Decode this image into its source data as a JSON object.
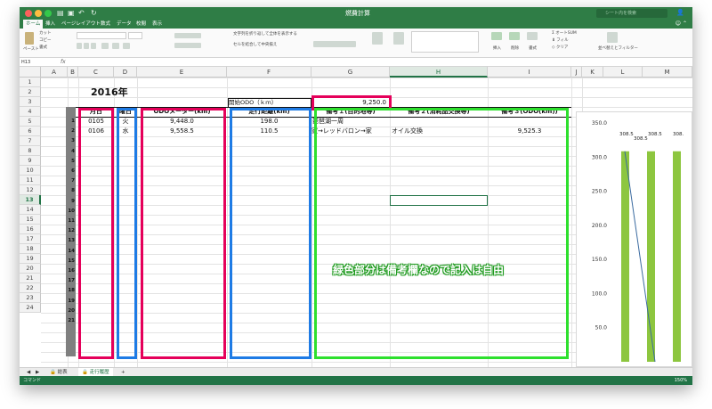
{
  "window": {
    "title": "燃費計算",
    "search_placeholder": "シート内を検索"
  },
  "ribbon_tabs": [
    "ホーム",
    "挿入",
    "ページレイアウト",
    "数式",
    "データ",
    "校閲",
    "表示"
  ],
  "ribbon": {
    "paste": "ペースト",
    "cut": "カット",
    "copy": "コピー",
    "format": "書式",
    "wrap": "文字列を折り返して全体を表示する",
    "merge": "セルを結合して中央揃え",
    "autosum": "オートSUM",
    "fill": "フィル",
    "clear": "クリア",
    "insert": "挿入",
    "delete": "削除",
    "cell_format": "書式",
    "sort": "並べ替えとフィルター"
  },
  "formula_bar": {
    "name_box": "H13",
    "fx": "fx"
  },
  "columns": [
    "A",
    "B",
    "C",
    "D",
    "E",
    "F",
    "G",
    "H",
    "I",
    "J",
    "K",
    "L",
    "M"
  ],
  "rows": [
    "1",
    "2",
    "3",
    "4",
    "5",
    "6",
    "7",
    "8",
    "9",
    "10",
    "11",
    "12",
    "13",
    "14",
    "15",
    "16",
    "17",
    "18",
    "19",
    "20",
    "21",
    "22",
    "23",
    "24"
  ],
  "sheet": {
    "year_title": "2016年",
    "start_odo_label": "開始ODO（ｋｍ）",
    "start_odo_value": "9,250.0",
    "headers": {
      "date": "月日",
      "weekday": "曜日",
      "odo": "ODOメーター(km)",
      "distance": "走行距離(km)",
      "note1": "備考１(目的地等)",
      "note2": "備考２(消耗品交換等)",
      "note3": "備考３(ODO(km))"
    },
    "numbers": [
      "1",
      "2",
      "3",
      "4",
      "5",
      "6",
      "7",
      "8",
      "9",
      "10",
      "11",
      "12",
      "13",
      "14",
      "15",
      "16",
      "17",
      "18",
      "19",
      "20",
      "21"
    ],
    "records": [
      {
        "date": "0105",
        "weekday": "火",
        "odo": "9,448.0",
        "distance": "198.0",
        "note1": "琵琶湖一周",
        "note2": "",
        "note3": ""
      },
      {
        "date": "0106",
        "weekday": "水",
        "odo": "9,558.5",
        "distance": "110.5",
        "note1": "家→レッドバロン→家",
        "note2": "オイル交換",
        "note3": "9,525.3"
      }
    ],
    "annotation": "緑色部分は備考欄なので記入は自由"
  },
  "colors": {
    "pink": "#e5005a",
    "blue": "#1e7be5",
    "green": "#2ee02e",
    "excel_green": "#217346"
  },
  "chart_data": {
    "type": "bar",
    "y_ticks": [
      "350.0",
      "300.0",
      "250.0",
      "200.0",
      "150.0",
      "100.0",
      "50.0"
    ],
    "ylim": [
      0,
      350
    ],
    "bar_labels": [
      "308.5",
      "308.5",
      "308.5",
      "308."
    ],
    "series": [
      {
        "values": [
          308.5,
          308.5,
          308.5
        ]
      }
    ],
    "line_series": {
      "values": [
        308.5,
        0
      ]
    }
  },
  "sheet_tabs": [
    "総表",
    "走行履歴"
  ],
  "status": {
    "mode": "コマンド",
    "zoom": "150%"
  }
}
